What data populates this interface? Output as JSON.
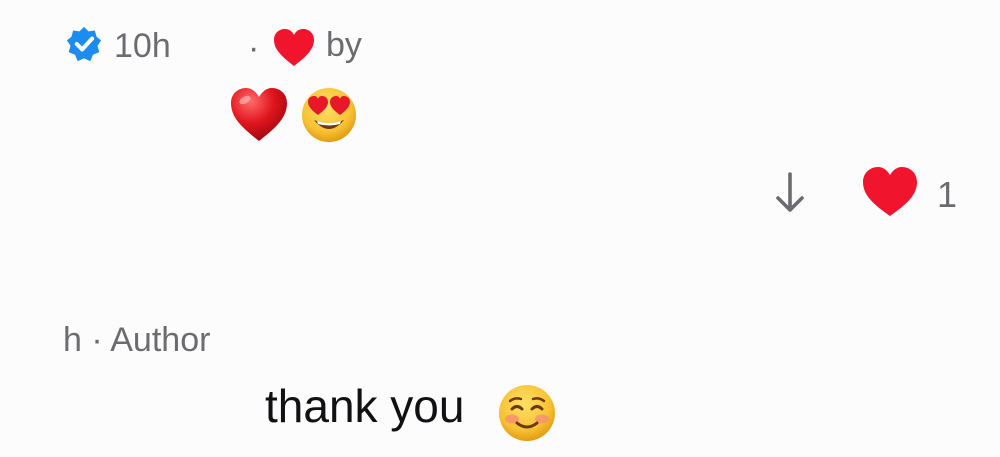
{
  "comment": {
    "verified_icon": "verified-badge-icon",
    "time": "10h",
    "separator": "·",
    "liked_by_label": "by",
    "reactions": [
      "red-heart-emoji",
      "heart-eyes-emoji"
    ],
    "like_count": "1",
    "download_icon": "arrow-down-icon"
  },
  "reply": {
    "meta": "h · Author",
    "text": "thank you",
    "emoji": "smiling-face-emoji"
  },
  "colors": {
    "verified_blue": "#1d8cf0",
    "heart_red": "#f0142d",
    "meta_gray": "#6b6b70"
  }
}
